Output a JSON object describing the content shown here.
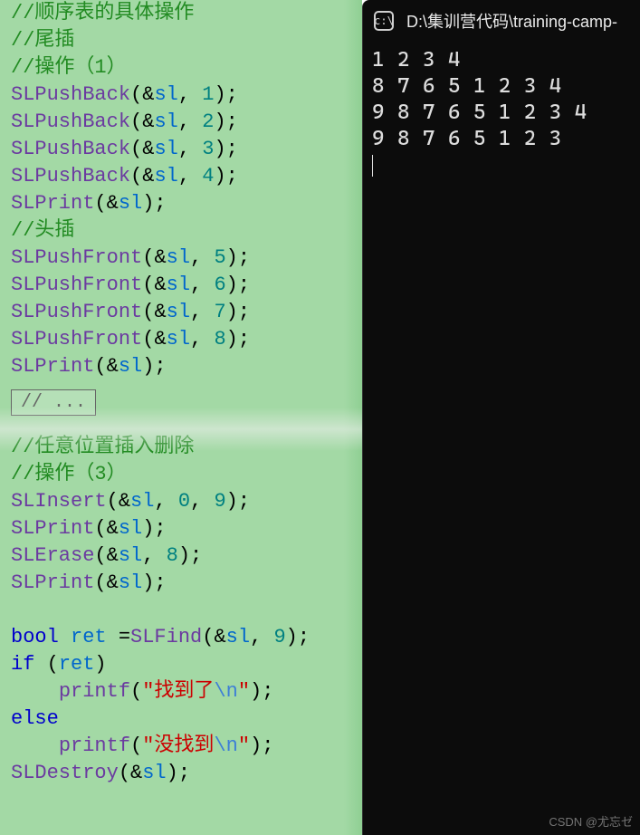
{
  "editor": {
    "foldLabel": "// ...",
    "lines": [
      {
        "t": "comment",
        "v": "//顺序表的具体操作"
      },
      {
        "t": "comment",
        "v": "//尾插"
      },
      {
        "t": "comment",
        "v": "//操作（1）"
      },
      {
        "t": "call",
        "fn": "SLPushBack",
        "args": [
          "&",
          "sl",
          ", ",
          "1"
        ],
        "tail": ");"
      },
      {
        "t": "call",
        "fn": "SLPushBack",
        "args": [
          "&",
          "sl",
          ", ",
          "2"
        ],
        "tail": ");"
      },
      {
        "t": "call",
        "fn": "SLPushBack",
        "args": [
          "&",
          "sl",
          ", ",
          "3"
        ],
        "tail": ");"
      },
      {
        "t": "call",
        "fn": "SLPushBack",
        "args": [
          "&",
          "sl",
          ", ",
          "4"
        ],
        "tail": ");"
      },
      {
        "t": "call",
        "fn": "SLPrint",
        "args": [
          "&",
          "sl"
        ],
        "tail": ");"
      },
      {
        "t": "comment",
        "v": "//头插"
      },
      {
        "t": "call",
        "fn": "SLPushFront",
        "args": [
          "&",
          "sl",
          ", ",
          "5"
        ],
        "tail": ");"
      },
      {
        "t": "call",
        "fn": "SLPushFront",
        "args": [
          "&",
          "sl",
          ", ",
          "6"
        ],
        "tail": ");"
      },
      {
        "t": "call",
        "fn": "SLPushFront",
        "args": [
          "&",
          "sl",
          ", ",
          "7"
        ],
        "tail": ");"
      },
      {
        "t": "call",
        "fn": "SLPushFront",
        "args": [
          "&",
          "sl",
          ", ",
          "8"
        ],
        "tail": ");"
      },
      {
        "t": "call",
        "fn": "SLPrint",
        "args": [
          "&",
          "sl"
        ],
        "tail": ");"
      },
      {
        "t": "fold"
      },
      {
        "t": "comment",
        "v": "//任意位置插入删除"
      },
      {
        "t": "comment",
        "v": "//操作（3）"
      },
      {
        "t": "call",
        "fn": "SLInsert",
        "args": [
          "&",
          "sl",
          ", ",
          "0",
          ", ",
          "9"
        ],
        "tail": ");"
      },
      {
        "t": "call",
        "fn": "SLPrint",
        "args": [
          "&",
          "sl"
        ],
        "tail": ");"
      },
      {
        "t": "call",
        "fn": "SLErase",
        "args": [
          "&",
          "sl",
          ", ",
          "8"
        ],
        "tail": ");"
      },
      {
        "t": "call",
        "fn": "SLPrint",
        "args": [
          "&",
          "sl"
        ],
        "tail": ");"
      },
      {
        "t": "blank"
      },
      {
        "t": "decl",
        "kw": "bool",
        "name": "ret",
        "fn": "SLFind",
        "args": [
          "&",
          "sl",
          ", ",
          "9"
        ],
        "tail": ");"
      },
      {
        "t": "ifcond",
        "kw": "if",
        "cond": "ret"
      },
      {
        "t": "printf",
        "indent": "    ",
        "fn": "printf",
        "strOpen": "\"",
        "strBody": "找到了",
        "esc": "\\n",
        "strClose": "\"",
        "tail": ");"
      },
      {
        "t": "keyword",
        "kw": "else"
      },
      {
        "t": "printf",
        "indent": "    ",
        "fn": "printf",
        "strOpen": "\"",
        "strBody": "没找到",
        "esc": "\\n",
        "strClose": "\"",
        "tail": ");"
      },
      {
        "t": "call",
        "fn": "SLDestroy",
        "args": [
          "&",
          "sl"
        ],
        "tail": ");"
      }
    ]
  },
  "terminal": {
    "iconGlyph": "c:\\",
    "title": "D:\\集训营代码\\training-camp-",
    "output": [
      "1 2 3 4",
      "8 7 6 5 1 2 3 4",
      "9 8 7 6 5 1 2 3 4",
      "9 8 7 6 5 1 2 3"
    ]
  },
  "watermark": "CSDN @尤忘ゼ"
}
